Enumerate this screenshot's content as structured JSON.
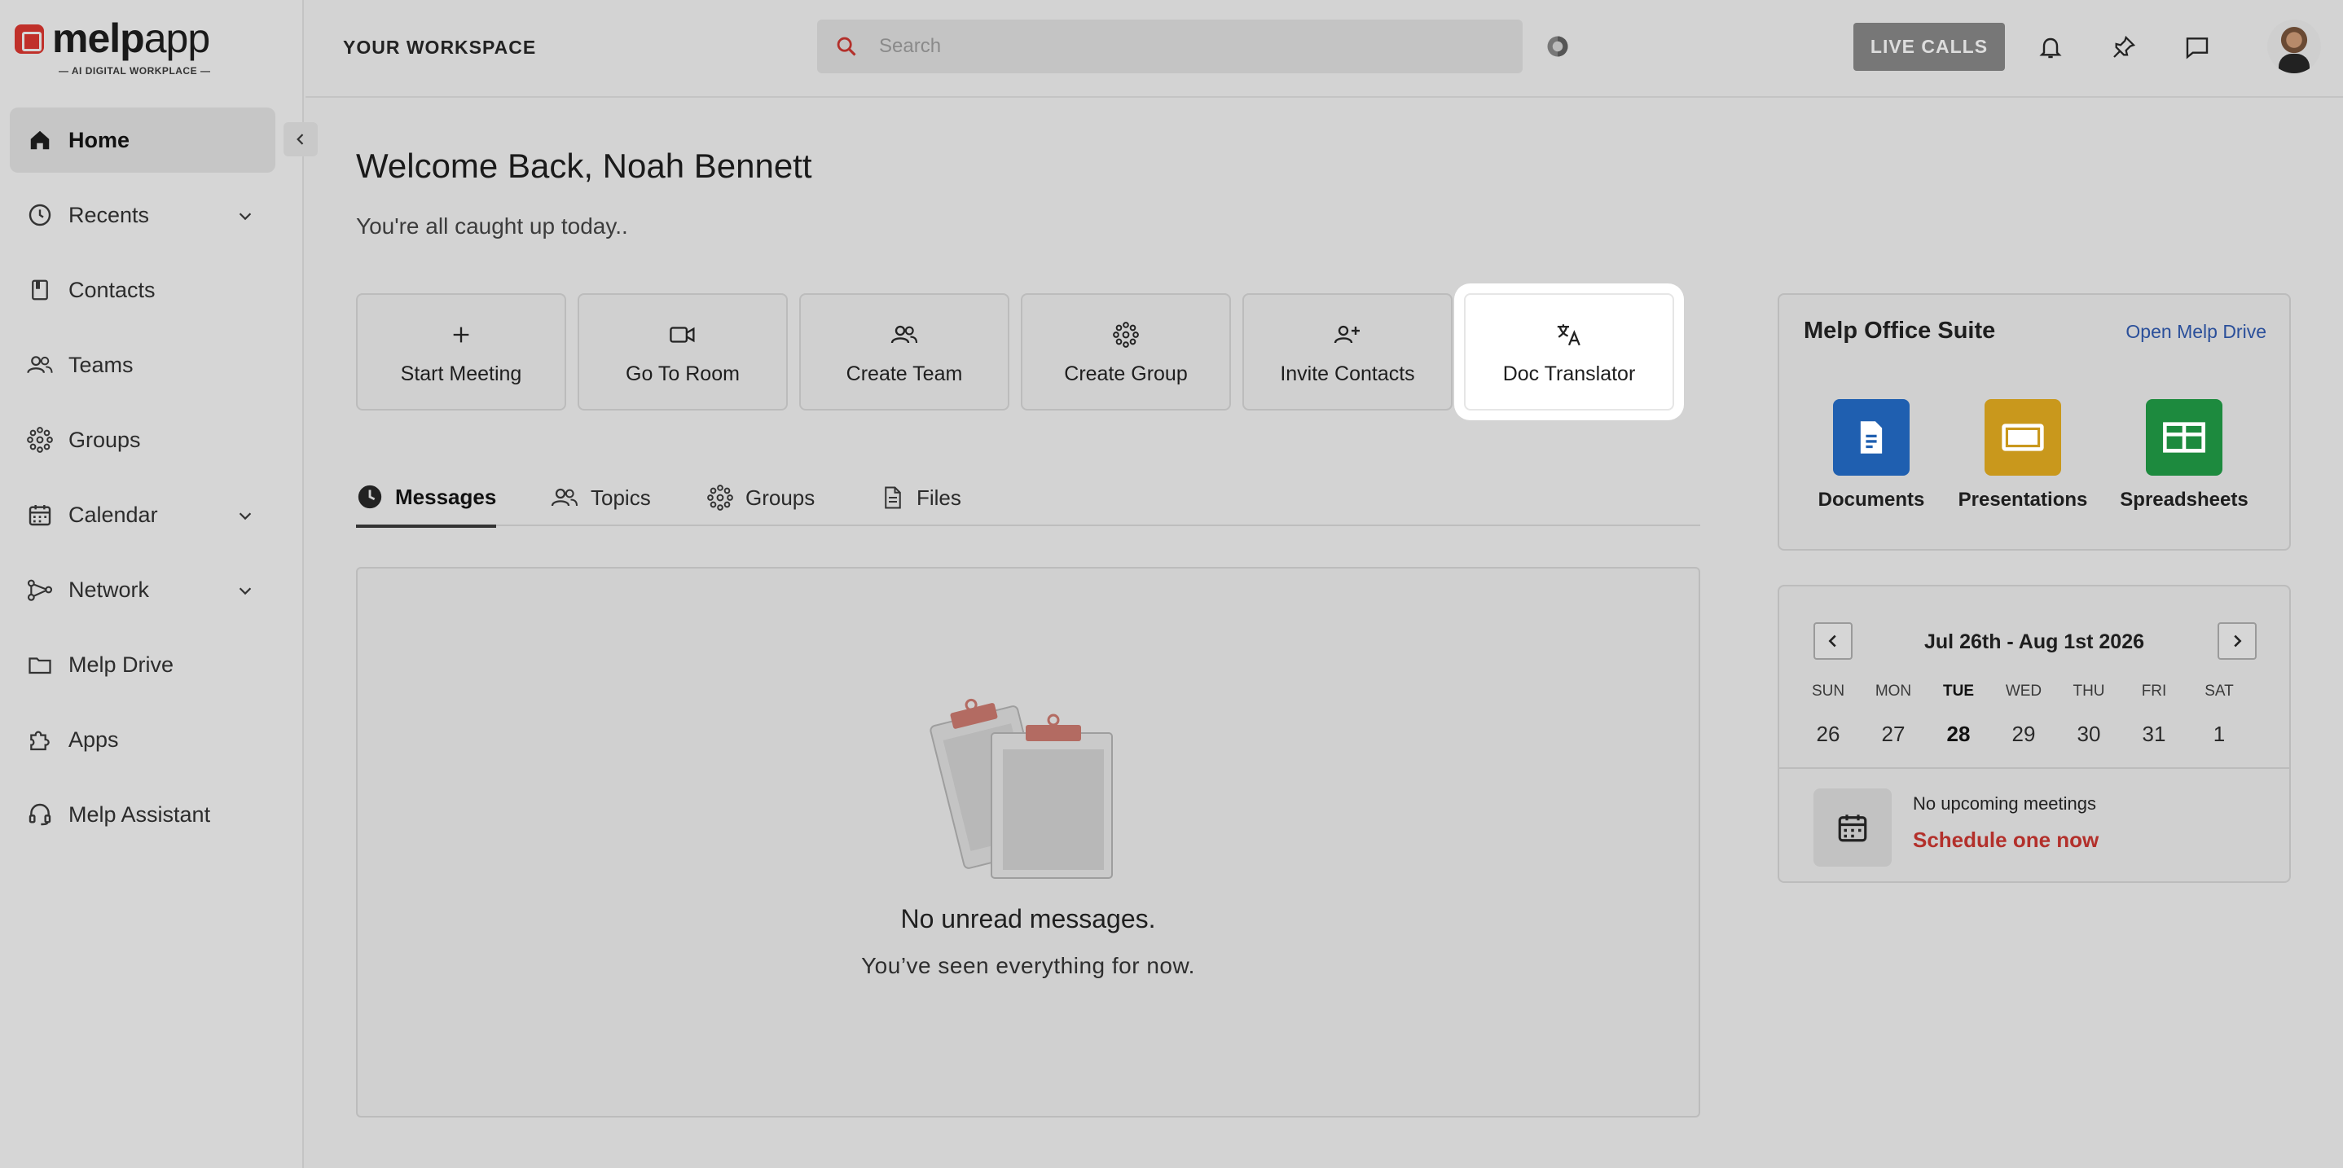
{
  "brand": {
    "name_bold": "melp",
    "name_light": "app",
    "tagline": "— AI DIGITAL WORKPLACE —"
  },
  "sidebar": {
    "items": [
      {
        "label": "Home",
        "icon": "home-icon",
        "active": true
      },
      {
        "label": "Recents",
        "icon": "clock-icon",
        "expandable": true
      },
      {
        "label": "Contacts",
        "icon": "contacts-book-icon"
      },
      {
        "label": "Teams",
        "icon": "people-icon"
      },
      {
        "label": "Groups",
        "icon": "groups-dots-icon"
      },
      {
        "label": "Calendar",
        "icon": "calendar-icon",
        "expandable": true
      },
      {
        "label": "Network",
        "icon": "network-icon",
        "expandable": true
      },
      {
        "label": "Melp Drive",
        "icon": "folder-icon"
      },
      {
        "label": "Apps",
        "icon": "puzzle-icon"
      },
      {
        "label": "Melp Assistant",
        "icon": "headset-icon"
      }
    ]
  },
  "topbar": {
    "workspace": "YOUR WORKSPACE",
    "search_placeholder": "Search",
    "live_calls": "LIVE CALLS"
  },
  "main": {
    "welcome": "Welcome Back, Noah Bennett",
    "subtitle": "You're all caught up today..",
    "actions": [
      {
        "label": "Start Meeting",
        "icon": "plus-icon"
      },
      {
        "label": "Go To Room",
        "icon": "video-camera-icon"
      },
      {
        "label": "Create Team",
        "icon": "team-icon"
      },
      {
        "label": "Create Group",
        "icon": "group-dots-icon"
      },
      {
        "label": "Invite Contacts",
        "icon": "add-person-icon"
      },
      {
        "label": "Doc Translator",
        "icon": "translate-icon",
        "highlighted": true
      }
    ],
    "tabs": [
      {
        "label": "Messages",
        "active": true
      },
      {
        "label": "Topics"
      },
      {
        "label": "Groups"
      },
      {
        "label": "Files"
      }
    ],
    "empty_title": "No unread messages.",
    "empty_subtitle": "You’ve seen everything for now."
  },
  "suite": {
    "title": "Melp Office Suite",
    "link": "Open Melp Drive",
    "apps": [
      {
        "label": "Documents",
        "color": "#1f5fb0"
      },
      {
        "label": "Presentations",
        "color": "#c9981c"
      },
      {
        "label": "Spreadsheets",
        "color": "#1d8a3e"
      }
    ]
  },
  "calendar": {
    "range": "Jul 26th - Aug 1st 2026",
    "days": [
      {
        "name": "SUN",
        "date": "26"
      },
      {
        "name": "MON",
        "date": "27"
      },
      {
        "name": "TUE",
        "date": "28",
        "today": true
      },
      {
        "name": "WED",
        "date": "29"
      },
      {
        "name": "THU",
        "date": "30"
      },
      {
        "name": "FRI",
        "date": "31"
      },
      {
        "name": "SAT",
        "date": "1"
      }
    ],
    "no_meetings": "No upcoming meetings",
    "schedule": "Schedule one now"
  },
  "colors": {
    "accent_red": "#b3302b",
    "link_blue": "#2a4f9a"
  }
}
